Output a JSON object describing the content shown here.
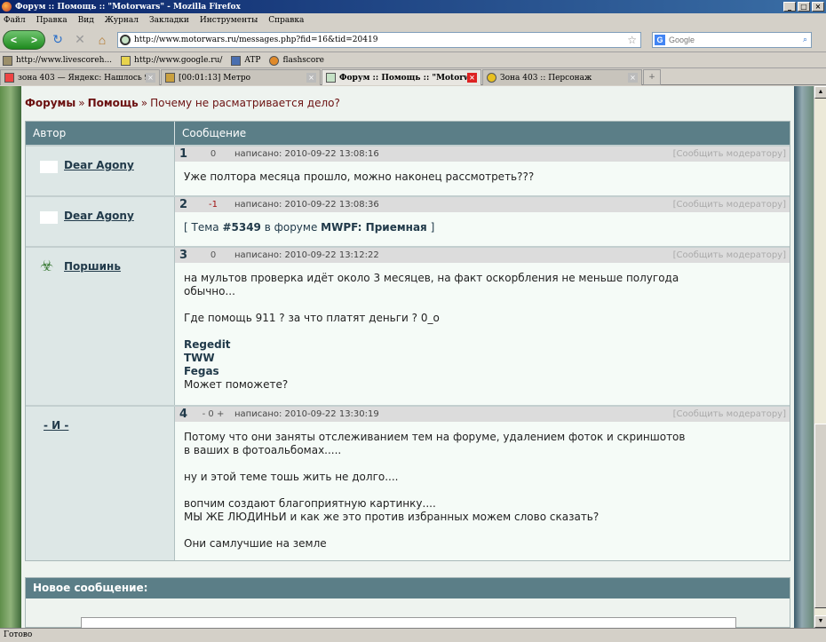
{
  "window": {
    "title": "Форум :: Помощь :: \"Motorwars\" - Mozilla Firefox",
    "controls": [
      "_",
      "□",
      "×"
    ]
  },
  "menu": [
    "Файл",
    "Правка",
    "Вид",
    "Журнал",
    "Закладки",
    "Инструменты",
    "Справка"
  ],
  "nav": {
    "back_glyph": "<",
    "forward_glyph": ">",
    "reload_glyph": "↻",
    "stop_glyph": "✕",
    "home_glyph": "⌂",
    "url": "http://www.motorwars.ru/messages.php?fid=16&tid=20419",
    "star_glyph": "☆",
    "search_engine": "G",
    "search_placeholder": "Google",
    "search_glyph": "⌕"
  },
  "bookmarks": [
    {
      "label": "http://www.livescoreh...",
      "icon": "site-icon"
    },
    {
      "label": "http://www.google.ru/",
      "icon": "google-icon"
    },
    {
      "label": "ATP",
      "icon": "atp-icon"
    },
    {
      "label": "flashscore",
      "icon": "flashscore-icon"
    }
  ],
  "tabs": [
    {
      "label": "зона 403 — Яндекс: Нашлось 978 тыс. ...",
      "active": false
    },
    {
      "label": "[00:01:13] Метро",
      "active": false
    },
    {
      "label": "Форум :: Помощь :: \"Motorwars\"",
      "active": true
    },
    {
      "label": "Зона 403 :: Персонаж",
      "active": false
    }
  ],
  "new_tab_glyph": "+",
  "breadcrumb": {
    "items": [
      "Форумы",
      "Помощь"
    ],
    "separator": "»",
    "current": "Почему не расматривается дело?"
  },
  "thread": {
    "col_author": "Автор",
    "col_message": "Сообщение",
    "posts": [
      {
        "number": "1",
        "author": "Dear Agony",
        "rating": "0",
        "written": "написано: 2010-09-22 13:08:16",
        "report": "[Сообщить модератору]",
        "lines": [
          "Уже полтора месяца прошло, можно наконец рассмотреть???"
        ]
      },
      {
        "number": "2",
        "author": "Dear Agony",
        "rating": "-1",
        "written": "написано: 2010-09-22 13:08:36",
        "report": "[Сообщить модератору]",
        "topic_prefix": "[ Тема ",
        "topic_id": "#5349",
        "topic_mid": " в форуме ",
        "topic_forum": "MWPF: Приемная",
        "topic_suffix": " ]"
      },
      {
        "number": "3",
        "author": "Поршинь",
        "author_icon": "biohazard-icon",
        "rating": "0",
        "written": "написано: 2010-09-22 13:12:22",
        "report": "[Сообщить модератору]",
        "lines": [
          "на мультов проверка идёт около 3 месяцев, на факт оскорбления не меньше полугода",
          "обычно...",
          "",
          "Где помощь 911 ? за что платят деньги ? 0_o",
          ""
        ],
        "bold_lines": [
          "Regedit",
          "TWW",
          "Fegas"
        ],
        "last_line": "Может поможете?"
      },
      {
        "number": "4",
        "author": "- И -",
        "rating": "- 0 +",
        "written": "написано: 2010-09-22 13:30:19",
        "report": "[Сообщить модератору]",
        "lines": [
          "Потому что они заняты отслеживанием тем на форуме, удалением фоток и скриншотов",
          "в ваших в фотоальбомах.....",
          "",
          "ну и этой теме тошь жить не долго....",
          "",
          "вопчим создают благоприятную картинку....",
          "МЫ ЖЕ ЛЮДИНЬИ и как же это против избранных можем слово сказать?",
          "",
          "Они самлучшие на земле"
        ]
      }
    ]
  },
  "new_message": {
    "header": "Новое сообщение:"
  },
  "status": "Готово"
}
